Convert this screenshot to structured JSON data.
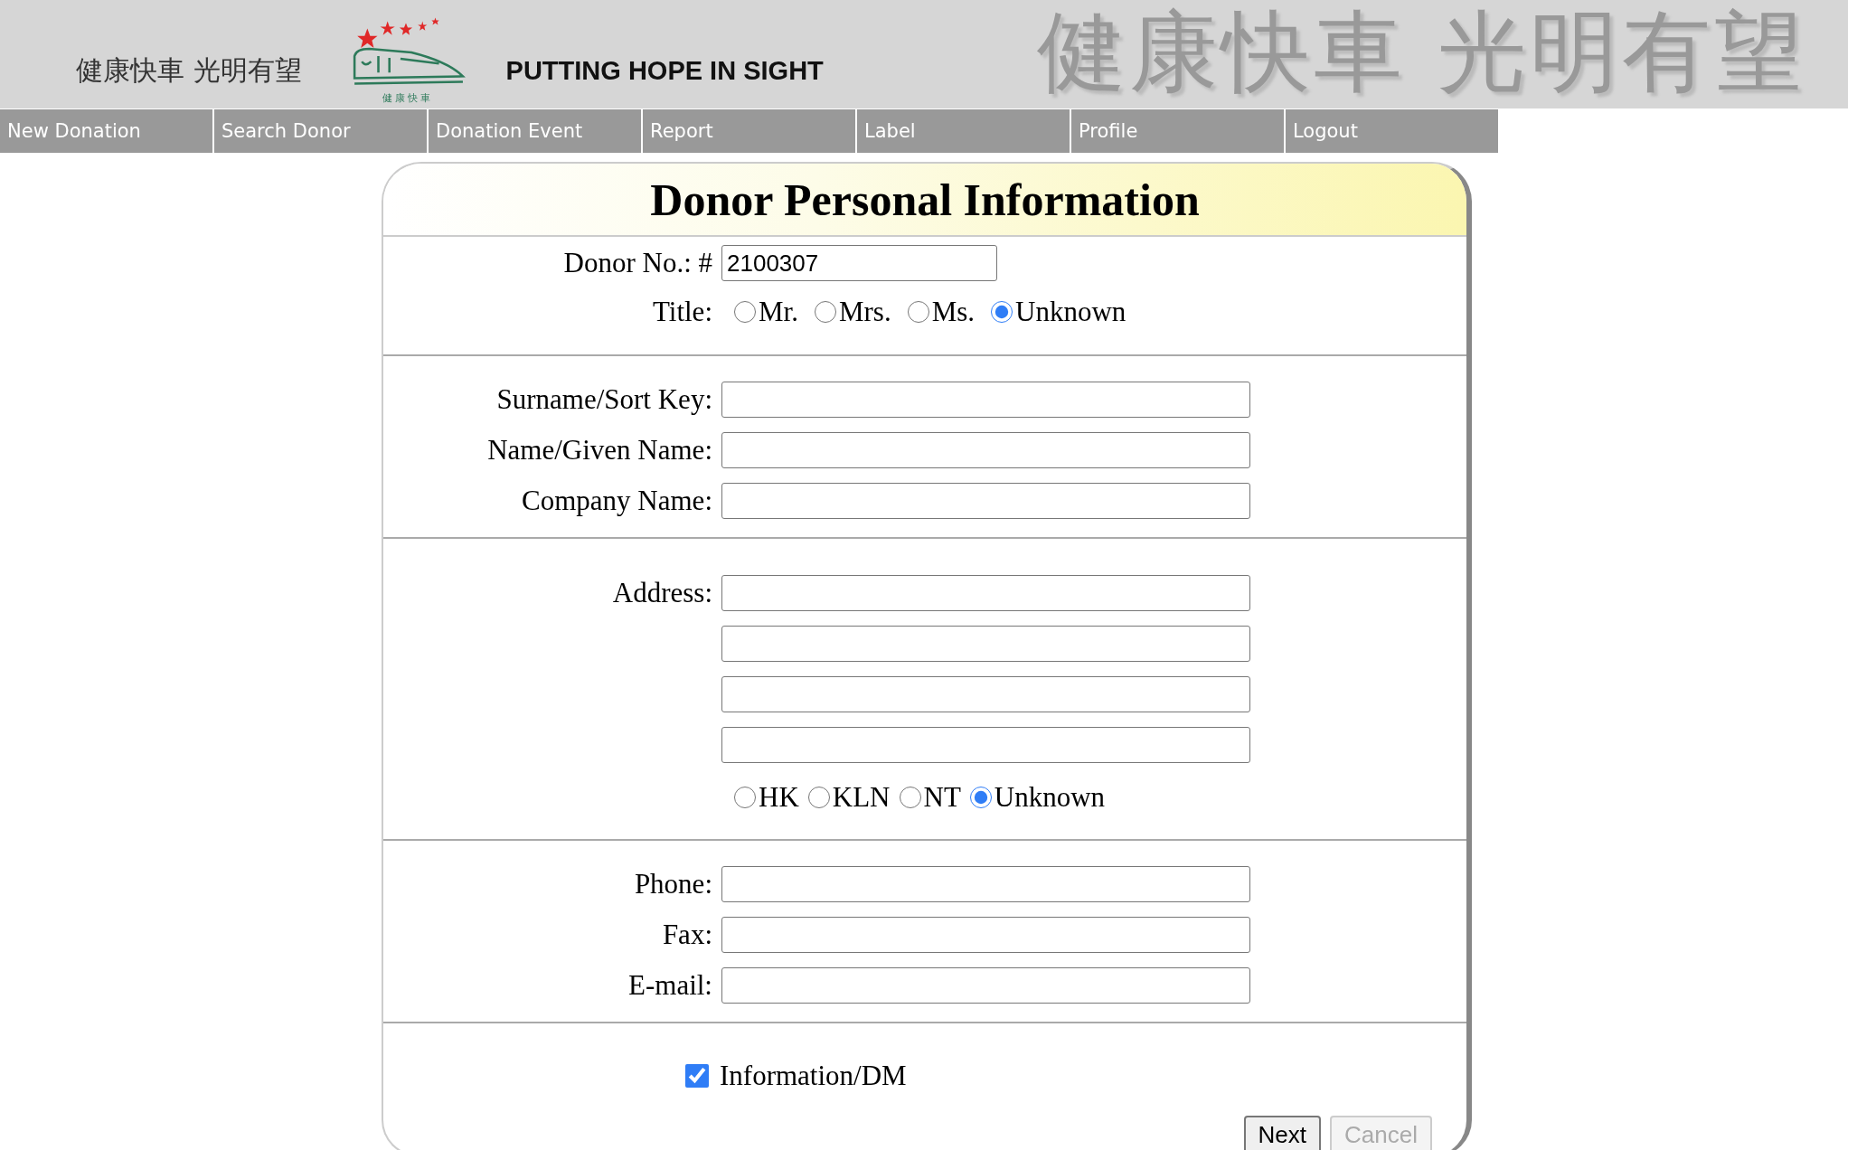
{
  "header": {
    "slogan": "健康快車 光明有望",
    "logo_caption": "健 康 快 車",
    "tagline": "PUTTING HOPE IN SIGHT",
    "banner": "健康快車 光明有望"
  },
  "nav": [
    {
      "label": "New Donation"
    },
    {
      "label": "Search Donor"
    },
    {
      "label": "Donation Event"
    },
    {
      "label": "Report"
    },
    {
      "label": "Label"
    },
    {
      "label": "Profile"
    },
    {
      "label": "Logout"
    }
  ],
  "form": {
    "title": "Donor Personal Information",
    "donor_no": {
      "label": "Donor No.: #",
      "value": "2100307"
    },
    "title_field": {
      "label": "Title:",
      "options": [
        {
          "label": "Mr.",
          "selected": false
        },
        {
          "label": "Mrs.",
          "selected": false
        },
        {
          "label": "Ms.",
          "selected": false
        },
        {
          "label": "Unknown",
          "selected": true
        }
      ]
    },
    "name_fields": [
      {
        "label": "Surname/Sort Key:"
      },
      {
        "label": "Name/Given Name:"
      },
      {
        "label": "Company Name:"
      }
    ],
    "address_fields": [
      {
        "kind": "labelled",
        "label": "Address:"
      },
      {
        "kind": "continuation"
      },
      {
        "kind": "continuation"
      },
      {
        "kind": "continuation"
      }
    ],
    "region": {
      "options": [
        {
          "label": "HK",
          "selected": false
        },
        {
          "label": "KLN",
          "selected": false
        },
        {
          "label": "NT",
          "selected": false
        },
        {
          "label": "Unknown",
          "selected": true
        }
      ]
    },
    "contact_fields": [
      {
        "label": "Phone:"
      },
      {
        "label": "Fax:"
      },
      {
        "label": "E-mail:"
      }
    ],
    "info_dm": {
      "label": "Information/DM",
      "checked": true
    },
    "buttons": [
      {
        "label": "Next",
        "disabled": false
      },
      {
        "label": "Cancel",
        "disabled": true
      }
    ]
  }
}
